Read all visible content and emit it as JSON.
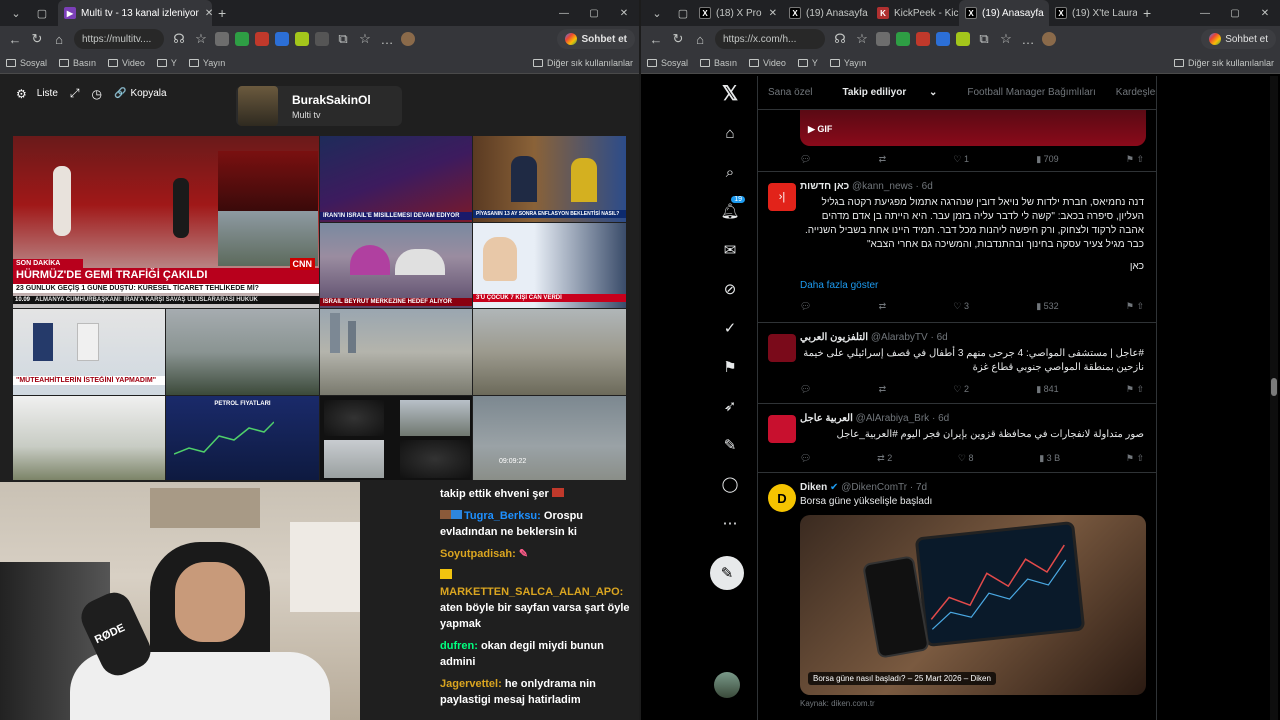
{
  "left_window": {
    "tabs": [
      {
        "title": "Multi tv - 13 kanal izleniyor",
        "active": true
      }
    ],
    "url": "https://multitv....",
    "gemini_label": "",
    "bookmarks": [
      "Sosyal",
      "Basın",
      "Video",
      "Y",
      "Yayın"
    ],
    "bookmarks_right": "Diğer sık kullanılanlar",
    "multitv": {
      "list_label": "Liste",
      "copy_label": "Kopyala",
      "profile_name": "BurakSakinOl",
      "profile_sub": "Multi tv"
    },
    "tiles": {
      "t1_caption1": "HÜRMÜZ'DE GEMİ TRAFİĞİ ÇAKILDI",
      "t1_caption2": "23 GÜNLÜK GEÇİŞ 1 GÜNE DÜŞTÜ: KÜRESEL TİCARET TEHLİKEDE Mİ?",
      "t1_breaking": "SON DAKİKA",
      "t1_ticker": "ALMANYA CUMHURBAŞKANI: İRAN'A KARŞI SAVAŞ ULUSLARARASI HUKUK",
      "t1_time": "10.09",
      "t1_brand": "CNN",
      "t2_caption": "İRAN'IN İSRAİL'E MİSİLLEMESİ DEVAM EDİYOR",
      "t3_caption": "PİYASANIN 13 AY SONRA ENFLASYON BEKLENTİSİ NASIL?",
      "t4_caption": "İSRAİL BEYRUT MERKEZİNE HEDEF ALIYOR",
      "t5_caption": "3'Ü ÇOCUK 7 KİŞİ CAN VERDİ",
      "t6_caption": "\"MÜTEAHHİTLERİN İSTEĞİNİ YAPMADIM\"",
      "t7_caption": "PETROL FİYATLARI",
      "t8_time": "09:09:22"
    },
    "chat": [
      {
        "user": "",
        "text": "takip ettik ehveni şer",
        "cls": ""
      },
      {
        "user": "Tugra_Berksu:",
        "text": "Orospu evladından ne beklersin ki",
        "cls": "u1"
      },
      {
        "user": "Soyutpadisah:",
        "text": "",
        "cls": "u2"
      },
      {
        "user": "MARKETTEN_SALCA_ALAN_APO:",
        "text": "aten böyle bir sayfan varsa şart öyle yapmak",
        "cls": "u3"
      },
      {
        "user": "dufren:",
        "text": "okan degil miydi bunun admini",
        "cls": "u4"
      },
      {
        "user": "Jagervettel:",
        "text": "he onlydrama nin paylastigi mesaj hatirladim",
        "cls": "u5"
      }
    ]
  },
  "right_window": {
    "tabs": [
      {
        "title": "(18) X Pro",
        "active": false
      },
      {
        "title": "(19) Anasayfa",
        "active": false
      },
      {
        "title": "KickPeek - Kic",
        "active": false
      },
      {
        "title": "(19) Anasayfa",
        "active": true
      },
      {
        "title": "(19) X'te Laura",
        "active": false
      }
    ],
    "url": "https://x.com/h...",
    "gemini_label": "Sohbet et",
    "bookmarks": [
      "Sosyal",
      "Basın",
      "Video",
      "Y",
      "Yayın"
    ],
    "bookmarks_right": "Diğer sık kullanılanlar",
    "badge": "19",
    "feed_tabs": [
      "Sana özel",
      "Takip ediliyor",
      "Football Manager Bağımlıları",
      "Kardeşler Kira"
    ],
    "gif_label": "GIF",
    "post0_stats": {
      "likes": "1",
      "views": "709"
    },
    "post1": {
      "name": "כאן חדשות",
      "handle": "@kann_news · 6d",
      "text": "דנה נחמיאס, חברת ילדות של נויאל דובין שנהרגה אתמול מפגיעת רקטה בגליל העליון, סיפרה בכאב: \"קשה לי לדבר עליה בזמן עבר. היא הייתה בן אדם מדהים אהבה לרקוד ולצחוק, ורק חיפשה ליהנות מכל דבר. תמיד היינו אחת בשביל השנייה. כבר מגיל צעיר עסקה בחינוך ובהתנדבות, והמשיכה גם אחרי הצבא\"",
      "sign": "כאן",
      "more": "Daha fazla göster",
      "likes": "3",
      "views": "532"
    },
    "post2": {
      "name": "التلفزيون العربي",
      "handle": "@AlarabyTV · 6d",
      "text": "#عاجل | مستشفى المواصي: 4 جرحى منهم 3 أطفال في قصف إسرائيلي على خيمة نازحين بمنطقة المواصي جنوبي قطاع غزة",
      "likes": "2",
      "views": "841"
    },
    "post3": {
      "name": "العربية عاجل",
      "handle": "@AlArabiya_Brk · 6d",
      "text": "صور متداولة لانفجارات في محافظة قزوين بإيران فجر اليوم #العربية_عاجل",
      "retweets": "2",
      "likes": "8",
      "views": "3 B"
    },
    "post4": {
      "name": "Diken",
      "handle": "@DikenComTr · 7d",
      "text": "Borsa güne yükselişle başladı",
      "card_caption": "Borsa güne nasıl başladı? – 25 Mart 2026 – Diken",
      "source": "Kaynak: diken.com.tr"
    }
  }
}
